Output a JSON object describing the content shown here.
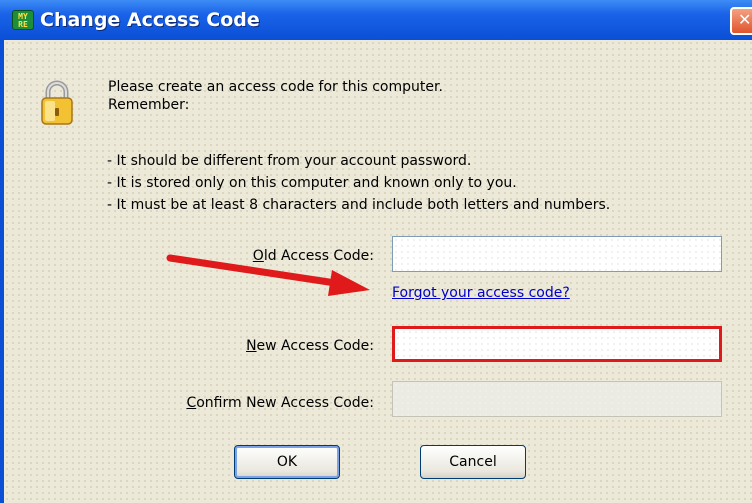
{
  "window": {
    "title": "Change Access Code",
    "app_icon_text": "MY\nRE",
    "close_glyph": "✕"
  },
  "intro": {
    "line1": "Please create an access code for this computer.",
    "line2": "Remember:"
  },
  "bullets": [
    "- It should be different from your account password.",
    "- It is stored only on this computer and known only to you.",
    "- It must be at least 8 characters and include both letters and numbers."
  ],
  "form": {
    "old_label": "Old Access Code:",
    "old_label_mnemonic": "O",
    "new_label": "New Access Code:",
    "new_label_mnemonic": "N",
    "confirm_label": "Confirm New Access Code:",
    "confirm_label_mnemonic": "C",
    "old_value": "",
    "new_value": "",
    "confirm_value": "",
    "forgot_link": "Forgot your access code?"
  },
  "buttons": {
    "ok": "OK",
    "cancel": "Cancel"
  },
  "colors": {
    "title_bar": "#0a4fd6",
    "annotation_arrow": "#e01a1a",
    "highlight_border": "#e01a1a",
    "link": "#0000cc"
  }
}
